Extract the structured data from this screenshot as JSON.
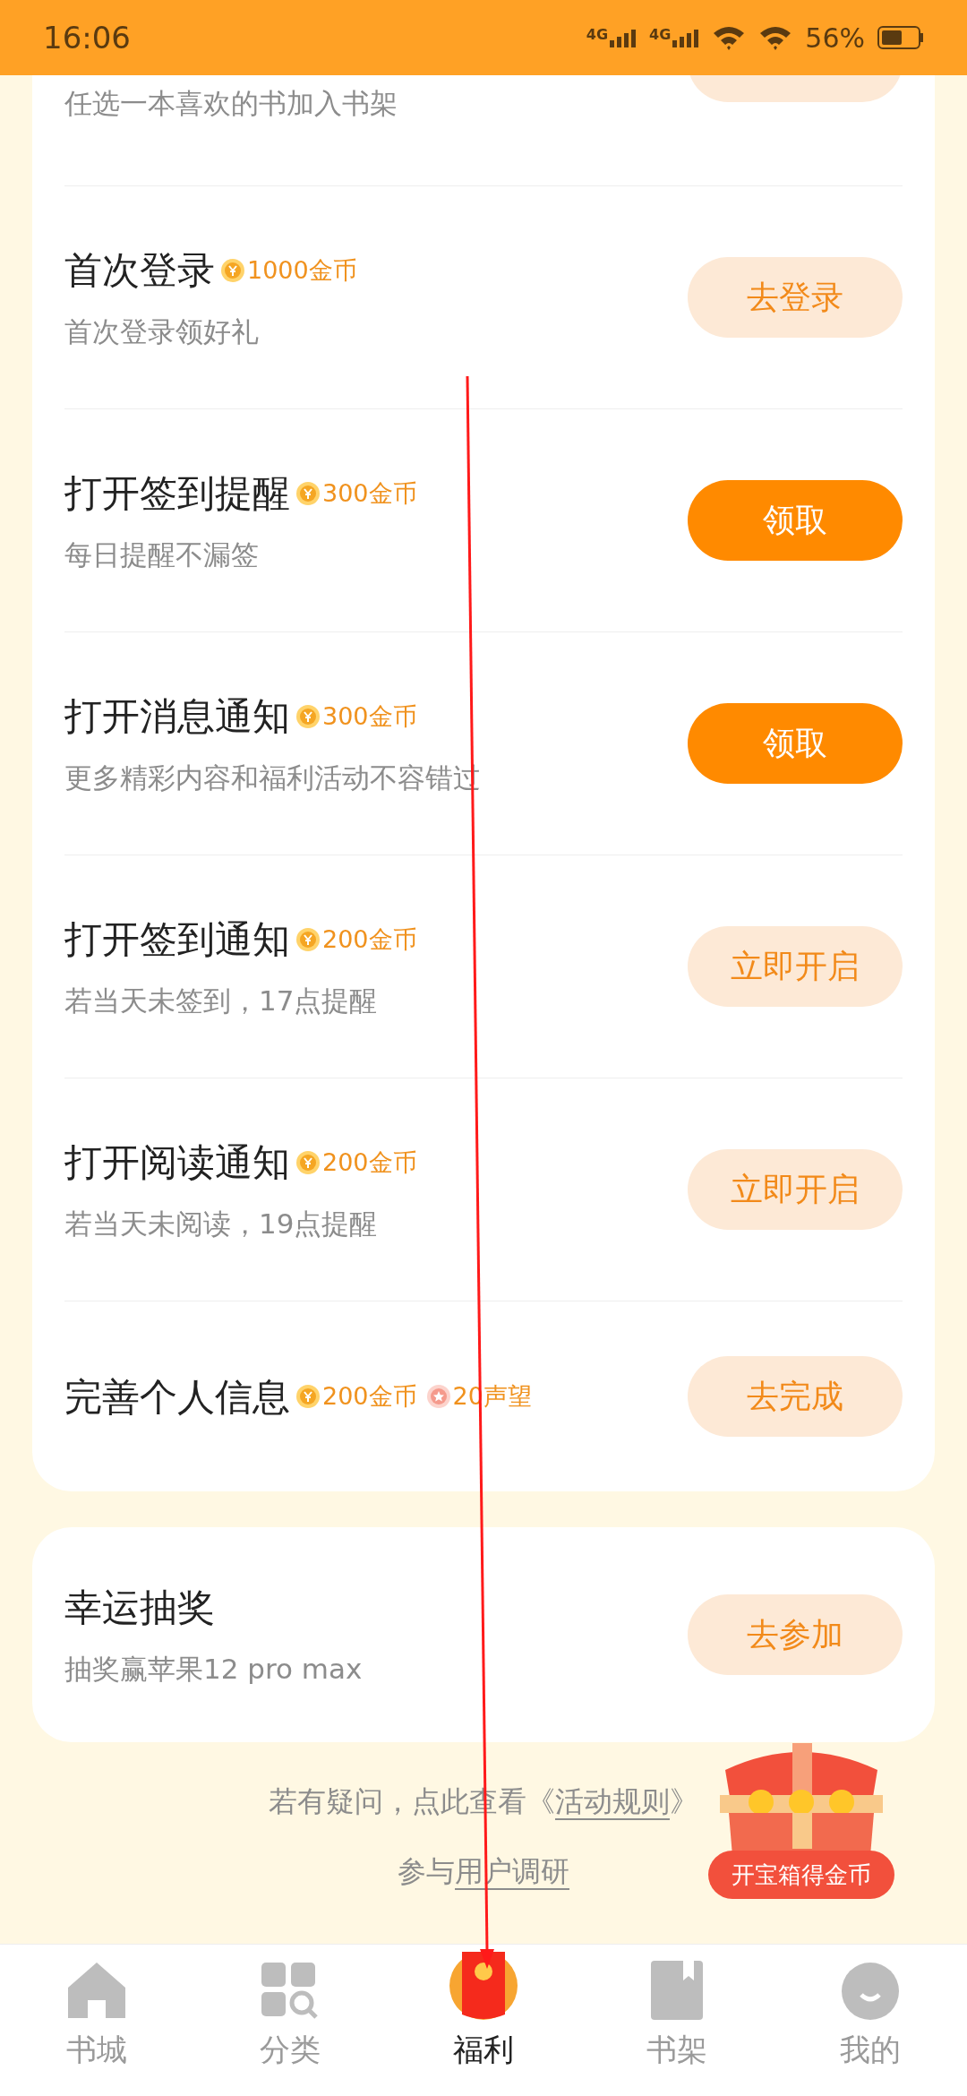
{
  "status_bar": {
    "time": "16:06",
    "network": [
      "4G",
      "4G"
    ],
    "battery": "56%"
  },
  "partial_task": {
    "subtitle": "任选一本喜欢的书加入书架"
  },
  "tasks": [
    {
      "title": "首次登录",
      "rewards": [
        {
          "kind": "coin",
          "text": "1000金币"
        }
      ],
      "subtitle": "首次登录领好礼",
      "button": {
        "label": "去登录",
        "highlighted": false
      }
    },
    {
      "title": "打开签到提醒",
      "rewards": [
        {
          "kind": "coin",
          "text": "300金币"
        }
      ],
      "subtitle": "每日提醒不漏签",
      "button": {
        "label": "领取",
        "highlighted": true
      }
    },
    {
      "title": "打开消息通知",
      "rewards": [
        {
          "kind": "coin",
          "text": "300金币"
        }
      ],
      "subtitle": "更多精彩内容和福利活动不容错过",
      "button": {
        "label": "领取",
        "highlighted": true
      }
    },
    {
      "title": "打开签到通知",
      "rewards": [
        {
          "kind": "coin",
          "text": "200金币"
        }
      ],
      "subtitle": "若当天未签到，17点提醒",
      "button": {
        "label": "立即开启",
        "highlighted": false
      }
    },
    {
      "title": "打开阅读通知",
      "rewards": [
        {
          "kind": "coin",
          "text": "200金币"
        }
      ],
      "subtitle": "若当天未阅读，19点提醒",
      "button": {
        "label": "立即开启",
        "highlighted": false
      }
    },
    {
      "title": "完善个人信息",
      "rewards": [
        {
          "kind": "coin",
          "text": "200金币"
        },
        {
          "kind": "reputation",
          "text": "20声望"
        }
      ],
      "button": {
        "label": "去完成",
        "highlighted": false
      }
    }
  ],
  "lottery": {
    "title": "幸运抽奖",
    "subtitle": "抽奖赢苹果12 pro max",
    "button": {
      "label": "去参加",
      "highlighted": false
    }
  },
  "footer": {
    "rules_prefix": "若有疑问，点此查看《",
    "rules_link": "活动规则",
    "rules_suffix": "》",
    "survey_prefix": "参与",
    "survey_link": "用户调研"
  },
  "treasure_chest": {
    "label": "开宝箱得金币"
  },
  "bottom_nav": [
    {
      "kind": "home",
      "label": "书城",
      "selected": false
    },
    {
      "kind": "category",
      "label": "分类",
      "selected": false
    },
    {
      "kind": "welfare",
      "label": "福利",
      "selected": true
    },
    {
      "kind": "shelf",
      "label": "书架",
      "selected": false
    },
    {
      "kind": "me",
      "label": "我的",
      "selected": false
    }
  ]
}
